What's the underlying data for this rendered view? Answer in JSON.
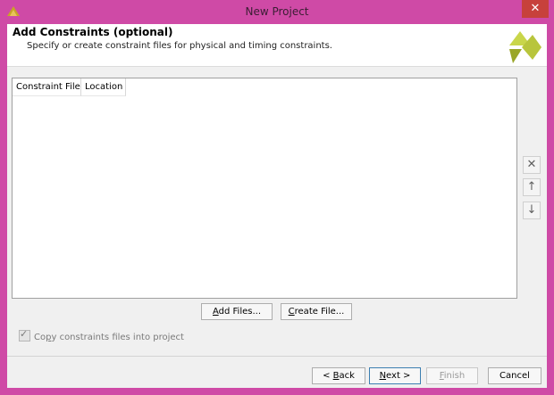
{
  "window": {
    "title": "New Project",
    "close_glyph": "✕"
  },
  "header": {
    "title": "Add Constraints (optional)",
    "subtitle": "Specify or create constraint files for physical and timing constraints."
  },
  "table": {
    "columns": [
      "Constraint File",
      "Location"
    ]
  },
  "side_buttons": {
    "remove": "✕",
    "move_up": "↑",
    "move_down": "↓"
  },
  "actions": {
    "add_files": {
      "pre": "",
      "key": "A",
      "post": "dd Files..."
    },
    "create_file": {
      "pre": "",
      "key": "C",
      "post": "reate File..."
    }
  },
  "copy_constraints": {
    "pre": "Co",
    "key": "p",
    "post": "y constraints files into project",
    "checked": true
  },
  "footer": {
    "back": {
      "pre": "< ",
      "key": "B",
      "post": "ack"
    },
    "next": {
      "pre": "",
      "key": "N",
      "post": "ext >"
    },
    "finish": {
      "pre": "",
      "key": "F",
      "post": "inish"
    },
    "cancel": "Cancel"
  },
  "colors": {
    "window_frame": "#cf4aa6",
    "close_button": "#c7413b",
    "logo_light": "#c9d64a",
    "logo_dark": "#9aa628"
  },
  "icons": {
    "app": "xilinx-logo-icon",
    "logo": "xilinx-logo-icon"
  }
}
